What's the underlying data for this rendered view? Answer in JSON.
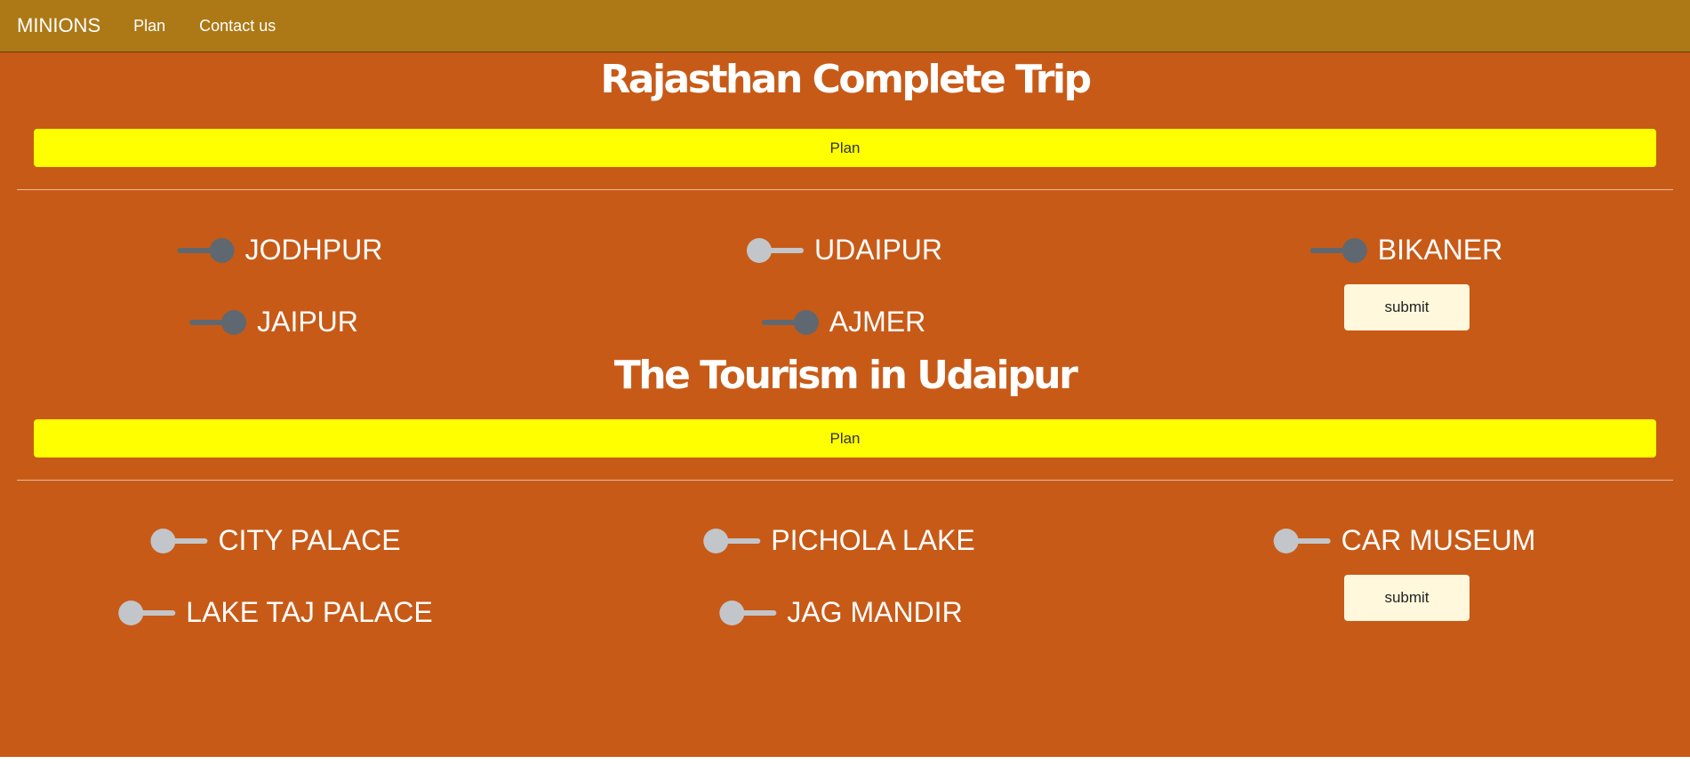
{
  "navbar": {
    "brand": "MINIONS",
    "links": [
      "Plan",
      "Contact us"
    ]
  },
  "sections": [
    {
      "title": "Rajasthan Complete Trip",
      "plan_label": "Plan",
      "options": [
        {
          "label": "JODHPUR",
          "checked": true
        },
        {
          "label": "UDAIPUR",
          "checked": false
        },
        {
          "label": "BIKANER",
          "checked": true
        },
        {
          "label": "JAIPUR",
          "checked": true
        },
        {
          "label": "AJMER",
          "checked": true
        }
      ],
      "submit_label": "submit"
    },
    {
      "title": "The Tourism in Udaipur",
      "plan_label": "Plan",
      "options": [
        {
          "label": "CITY PALACE",
          "checked": false
        },
        {
          "label": "PICHOLA LAKE",
          "checked": false
        },
        {
          "label": "CAR MUSEUM",
          "checked": false
        },
        {
          "label": "LAKE TAJ PALACE",
          "checked": false
        },
        {
          "label": "JAG MANDIR",
          "checked": false
        }
      ],
      "submit_label": "submit"
    }
  ],
  "colors": {
    "page_bg": "#c85a17",
    "navbar_bg": "#ac7916",
    "plan_bar": "#ffff00",
    "submit_bg": "#fff8dc",
    "toggle_on": "#5f6870",
    "toggle_off": "#c2c6ca"
  }
}
